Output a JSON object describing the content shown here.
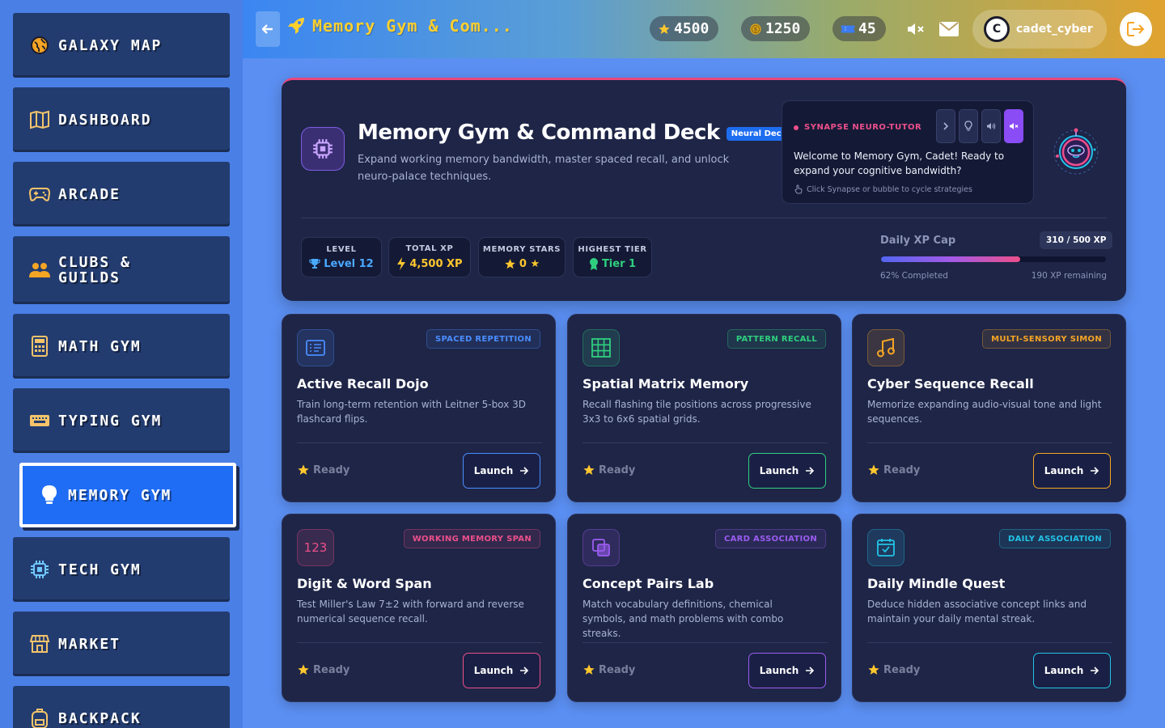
{
  "sidebar": {
    "items": [
      {
        "label": "GALAXY MAP",
        "icon": "globe-icon"
      },
      {
        "label": "DASHBOARD",
        "icon": "map-icon"
      },
      {
        "label": "ARCADE",
        "icon": "gamepad-icon"
      },
      {
        "label": "CLUBS &\nGUILDS",
        "icon": "people-icon"
      },
      {
        "label": "MATH GYM",
        "icon": "calculator-icon"
      },
      {
        "label": "TYPING GYM",
        "icon": "keyboard-icon"
      },
      {
        "label": "MEMORY GYM",
        "icon": "lightbulb-icon"
      },
      {
        "label": "TECH GYM",
        "icon": "chip-icon"
      },
      {
        "label": "MARKET",
        "icon": "store-icon"
      },
      {
        "label": "BACKPACK",
        "icon": "backpack-icon"
      }
    ],
    "active": "MEMORY GYM"
  },
  "header": {
    "title": "Memory Gym & Com...",
    "stars": "4500",
    "coins": "1250",
    "tickets": "45",
    "username": "cadet_cyber",
    "avatar_letter": "C"
  },
  "hero": {
    "title": "Memory Gym & Command Deck",
    "badge": "Neural Deck",
    "description": "Expand working memory bandwidth, master spaced recall, and unlock neuro-palace techniques.",
    "tutor": {
      "name": "SYNAPSE NEURO-TUTOR",
      "message": "Welcome to Memory Gym, Cadet! Ready to expand your cognitive bandwidth?",
      "hint": "Click Synapse or bubble to cycle strategies"
    },
    "metrics": [
      {
        "label": "LEVEL",
        "value": "Level 12",
        "color": "#4aa8ff",
        "icon": "trophy-icon"
      },
      {
        "label": "TOTAL XP",
        "value": "4,500 XP",
        "color": "#ffc72e",
        "icon": "bolt-icon"
      },
      {
        "label": "MEMORY STARS",
        "value": "0 ★",
        "color": "#ffc72e",
        "icon": "star-icon"
      },
      {
        "label": "HIGHEST TIER",
        "value": "Tier 1",
        "color": "#2fcf7f",
        "icon": "medal-icon"
      }
    ],
    "xp_cap": {
      "label": "Daily XP Cap",
      "value": "310 / 500 XP",
      "progress": 0.62,
      "completed": "62% Completed",
      "remaining": "190 XP remaining"
    }
  },
  "cards": [
    {
      "title": "Active Recall Dojo",
      "tag": "SPACED REPETITION",
      "desc": "Train long-term retention with Leitner 5-box 3D flashcard flips.",
      "status": "Ready",
      "button": "Launch",
      "accent": "#4a8dff",
      "icon": "flashcard-icon"
    },
    {
      "title": "Spatial Matrix Memory",
      "tag": "PATTERN RECALL",
      "desc": "Recall flashing tile positions across progressive 3x3 to 6x6 spatial grids.",
      "status": "Ready",
      "button": "Launch",
      "accent": "#2fcf7f",
      "icon": "grid-icon"
    },
    {
      "title": "Cyber Sequence Recall",
      "tag": "MULTI-SENSORY SIMON",
      "desc": "Memorize expanding audio-visual tone and light sequences.",
      "status": "Ready",
      "button": "Launch",
      "accent": "#f5a524",
      "icon": "music-icon"
    },
    {
      "title": "Digit & Word Span",
      "tag": "WORKING MEMORY SPAN",
      "desc": "Test Miller's Law 7±2 with forward and reverse numerical sequence recall.",
      "status": "Ready",
      "button": "Launch",
      "accent": "#ec4f8a",
      "icon": "digits-icon"
    },
    {
      "title": "Concept Pairs Lab",
      "tag": "CARD ASSOCIATION",
      "desc": "Match vocabulary definitions, chemical symbols, and math problems with combo streaks.",
      "status": "Ready",
      "button": "Launch",
      "accent": "#9b5cf0",
      "icon": "cards-icon"
    },
    {
      "title": "Daily Mindle Quest",
      "tag": "DAILY ASSOCIATION",
      "desc": "Deduce hidden associative concept links and maintain your daily mental streak.",
      "status": "Ready",
      "button": "Launch",
      "accent": "#22c3e6",
      "icon": "calendar-icon",
      "digits": "123"
    }
  ],
  "digit_icon_text": "123"
}
